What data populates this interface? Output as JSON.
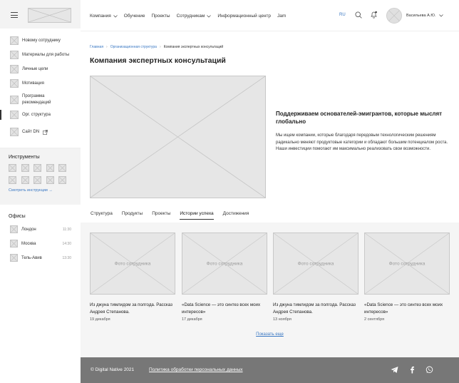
{
  "sidebar": {
    "items": [
      {
        "label": "Новому сотруднику",
        "icon": "placeholder-icon"
      },
      {
        "label": "Материалы для работы",
        "icon": "placeholder-icon"
      },
      {
        "label": "Личные цели",
        "icon": "placeholder-icon"
      },
      {
        "label": "Мотивация",
        "icon": "placeholder-icon"
      },
      {
        "label": "Программа рекомендаций",
        "icon": "placeholder-icon"
      },
      {
        "label": "Орг. структура",
        "icon": "placeholder-icon",
        "active": true
      },
      {
        "label": "Сайт DN",
        "icon": "placeholder-icon"
      }
    ],
    "tools_title": "Инструменты",
    "tools_link": "Смотреть инструкции →",
    "offices_title": "Офисы",
    "offices": [
      {
        "city": "Лондон",
        "time": "11:30"
      },
      {
        "city": "Москва",
        "time": "14:30"
      },
      {
        "city": "Тель-Авив",
        "time": "13:30"
      }
    ]
  },
  "header": {
    "nav": [
      {
        "label": "Компания",
        "dropdown": true
      },
      {
        "label": "Обучение",
        "dropdown": false
      },
      {
        "label": "Проекты",
        "dropdown": false
      },
      {
        "label": "Сотрудникам",
        "dropdown": true
      },
      {
        "label": "Информационный центр",
        "dropdown": false
      },
      {
        "label": "Jam",
        "dropdown": false
      }
    ],
    "lang": "RU",
    "username": "Васильева А.Ю."
  },
  "breadcrumb": {
    "home": "Главная",
    "section": "Организационная структура",
    "current": "Компания экспертных консультаций"
  },
  "page_title": "Компания экспертных консультаций",
  "hero": {
    "title": "Поддерживаем основателей-эмигрантов, которые мыслят глобально",
    "text": "Мы ищем компании, которые благодаря передовым технологическим решениям радикально меняют продуктовые категории и обладают большим потенциалом роста. Наши инвестиции помогают им максимально реализовать свои возможности."
  },
  "tabs": [
    {
      "label": "Структура"
    },
    {
      "label": "Продукты"
    },
    {
      "label": "Проекты"
    },
    {
      "label": "Истории успеха",
      "active": true
    },
    {
      "label": "Достижения"
    }
  ],
  "cards": [
    {
      "photo": "Фото сотрудника",
      "title": "Из джуна тимлидом за полгода. Рассказ Андрея Степанова.",
      "date": "19 декабря"
    },
    {
      "photo": "Фото сотрудника",
      "title": "«Data Science — это синтез всех моих интересов»",
      "date": "17 декабря"
    },
    {
      "photo": "Фото сотрудника",
      "title": "Из джуна тимлидом за полгода. Рассказ Андрея Степанова.",
      "date": "13 ноября"
    },
    {
      "photo": "Фото сотрудника",
      "title": "«Data Science — это синтез всех моих интересов»",
      "date": "2 сентября"
    }
  ],
  "show_more": "Показать еще",
  "footer": {
    "copyright": "© Digital Native 2021",
    "policy": "Политика обработки персональных данных",
    "social": [
      "telegram-icon",
      "facebook-icon",
      "whatsapp-icon"
    ]
  },
  "colors": {
    "link": "#3a78c3",
    "footer_bg": "#777777",
    "sidebar_bg": "#f3f3f3"
  }
}
